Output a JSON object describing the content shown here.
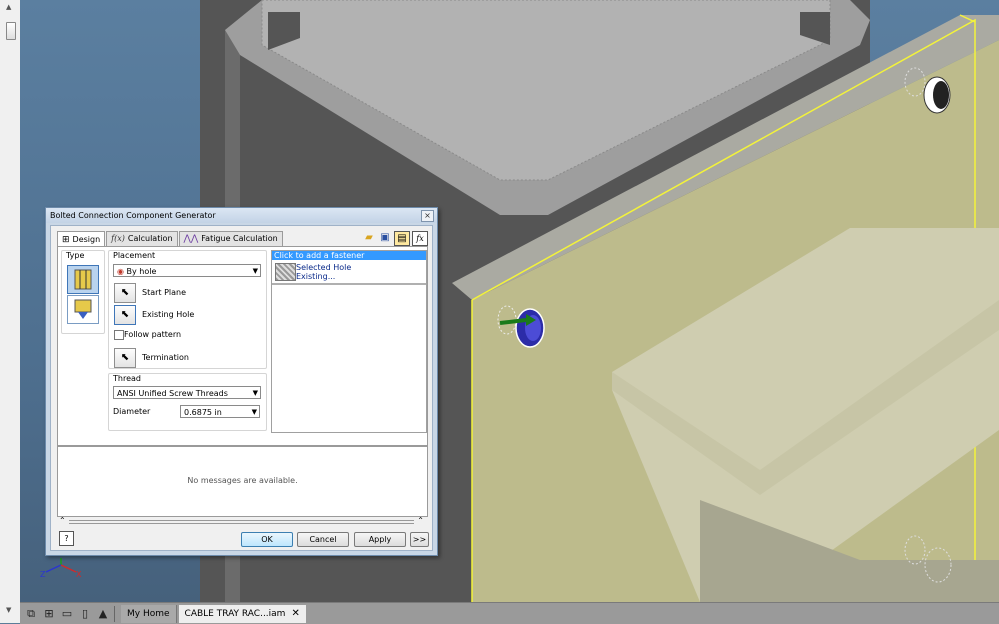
{
  "dialog": {
    "title": "Bolted Connection Component Generator",
    "close_glyph": "×",
    "tabs": [
      {
        "label": "Design",
        "icon": "design-icon"
      },
      {
        "label": "Calculation",
        "icon": "fx-icon"
      },
      {
        "label": "Fatigue Calculation",
        "icon": "fatigue-icon"
      }
    ],
    "toolbar_icons": [
      "open-folder-icon",
      "save-icon",
      "options-icon",
      "fx-icon"
    ],
    "type_label": "Type",
    "placement": {
      "label": "Placement",
      "mode": "By hole",
      "start_plane": "Start Plane",
      "existing_hole": "Existing Hole",
      "follow_pattern": "Follow pattern",
      "follow_pattern_checked": false,
      "termination": "Termination"
    },
    "thread": {
      "label": "Thread",
      "type": "ANSI Unified Screw Threads",
      "diameter_label": "Diameter",
      "diameter": "0.6875 in"
    },
    "fastener_list": {
      "selected": "Click to add a fastener",
      "items": [
        "Selected Hole",
        "Existing..."
      ]
    },
    "messages": "No messages are available.",
    "buttons": {
      "help": "?",
      "ok": "OK",
      "cancel": "Cancel",
      "apply": "Apply",
      "more": ">>"
    }
  },
  "document_tabs": {
    "home": "My Home",
    "doc": "CABLE TRAY RAC...iam",
    "close": "✕"
  },
  "colors": {
    "viewport_bg": "#4e6f8f",
    "selected_face": "#bdbb8c",
    "highlight_edge": "#f3f33a",
    "list_selection": "#3399ff"
  },
  "triad_labels": {
    "z": "Z",
    "x": "X"
  }
}
